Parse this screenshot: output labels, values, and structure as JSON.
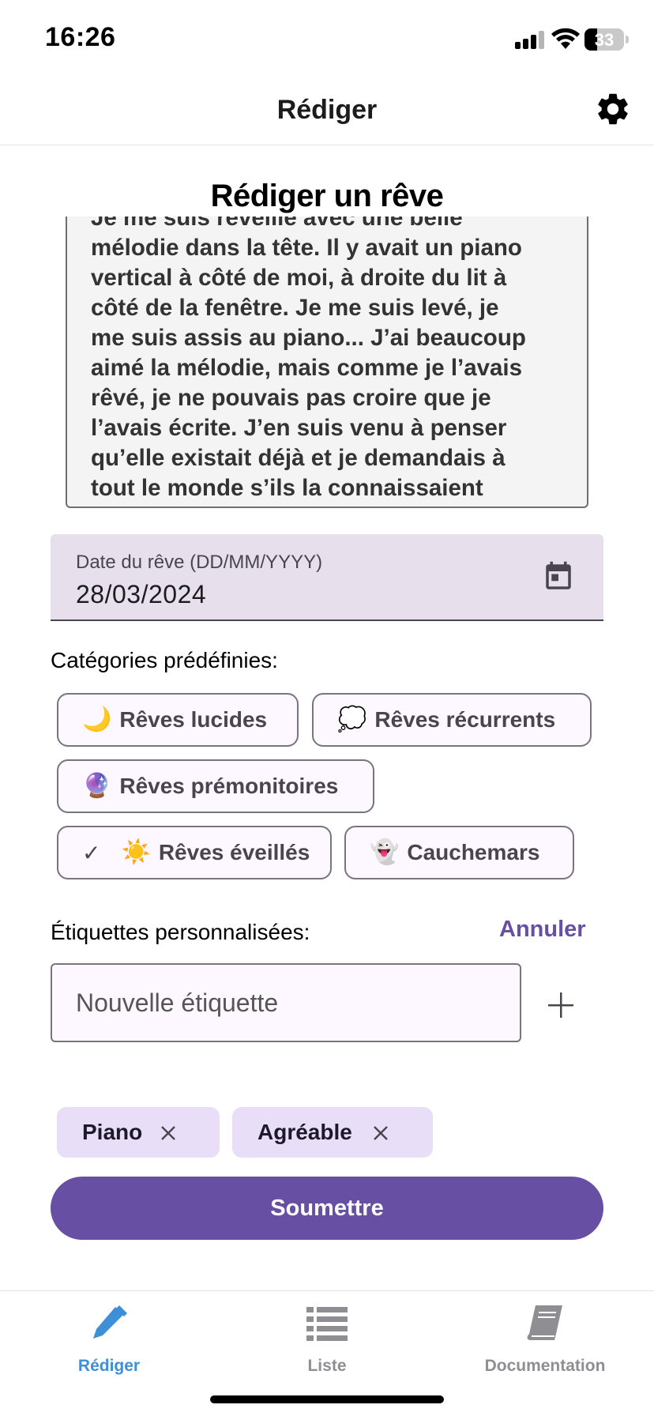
{
  "status_bar": {
    "time": "16:26",
    "battery_percent": "33"
  },
  "header": {
    "title": "Rédiger",
    "settings_icon": "gear-icon"
  },
  "form": {
    "title": "Rédiger un rêve",
    "dream_text": "Je me suis réveillé avec une belle\nmélodie dans la tête. Il y avait un piano\nvertical à côté de moi, à droite du lit à\ncôté de la fenêtre. Je me suis levé, je\nme suis assis au piano... J’ai beaucoup\naimé la mélodie, mais comme je l’avais\nrêvé, je ne pouvais pas croire que je\nl’avais écrite. J’en suis venu à penser\nqu’elle existait déjà et je demandais à\ntout le monde s’ils la connaissaient",
    "date_label": "Date du rêve (DD/MM/YYYY)",
    "date_value": "28/03/2024",
    "categories_label": "Catégories prédéfinies:",
    "categories": [
      {
        "emoji": "🌙",
        "label": "Rêves lucides",
        "selected": false
      },
      {
        "emoji": "💭",
        "label": "Rêves récurrents",
        "selected": false
      },
      {
        "emoji": "🔮",
        "label": "Rêves prémonitoires",
        "selected": false
      },
      {
        "emoji": "☀️",
        "label": "Rêves éveillés",
        "selected": true
      },
      {
        "emoji": "👻",
        "label": "Cauchemars",
        "selected": false
      }
    ],
    "custom_tags_label": "Étiquettes personnalisées:",
    "cancel_label": "Annuler",
    "tag_input_placeholder": "Nouvelle étiquette",
    "tags": [
      "Piano",
      "Agréable"
    ],
    "submit_label": "Soumettre"
  },
  "tab_bar": {
    "tabs": [
      {
        "label": "Rédiger",
        "icon": "pencil-icon",
        "active": true
      },
      {
        "label": "Liste",
        "icon": "list-icon",
        "active": false
      },
      {
        "label": "Documentation",
        "icon": "book-icon",
        "active": false
      }
    ]
  },
  "colors": {
    "accent": "#6750a4",
    "tab_active": "#3d8fd8",
    "tab_inactive": "#8e8e93",
    "chip_bg": "#e8def8",
    "field_bg": "#e7e0ec"
  }
}
